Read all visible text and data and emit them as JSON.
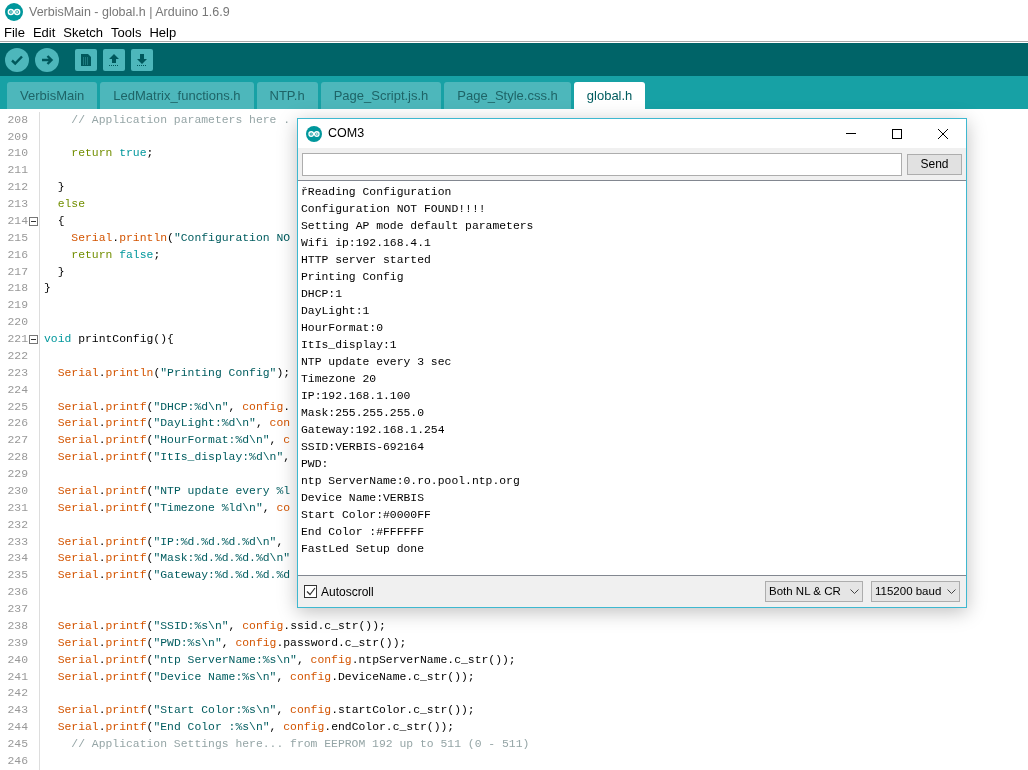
{
  "window": {
    "title": "VerbisMain - global.h | Arduino 1.6.9"
  },
  "menu": [
    "File",
    "Edit",
    "Sketch",
    "Tools",
    "Help"
  ],
  "tabs": [
    {
      "label": "VerbisMain",
      "selected": false
    },
    {
      "label": "LedMatrix_functions.h",
      "selected": false
    },
    {
      "label": "NTP.h",
      "selected": false
    },
    {
      "label": "Page_Script.js.h",
      "selected": false
    },
    {
      "label": "Page_Style.css.h",
      "selected": false
    },
    {
      "label": "global.h",
      "selected": true
    }
  ],
  "editor": {
    "lines": [
      {
        "number": "208",
        "fold": false,
        "code": [
          {
            "kind": "comment",
            "text": "    // Application parameters here ."
          }
        ]
      },
      {
        "number": "209",
        "fold": false
      },
      {
        "number": "210",
        "fold": false,
        "code": [
          {
            "kind": "keyword",
            "text": "    return"
          },
          {
            "kind": "literal",
            "text": " true"
          },
          {
            "kind": "plain",
            "text": ";"
          }
        ]
      },
      {
        "number": "211",
        "fold": false
      },
      {
        "number": "212",
        "fold": false,
        "code": [
          {
            "kind": "plain",
            "text": "  }"
          }
        ]
      },
      {
        "number": "213",
        "fold": false,
        "code": [
          {
            "kind": "keyword",
            "text": "  else"
          }
        ]
      },
      {
        "number": "214",
        "fold": true,
        "code": [
          {
            "kind": "plain",
            "text": "  {"
          }
        ]
      },
      {
        "number": "215",
        "fold": false,
        "code": [
          {
            "kind": "class",
            "text": "    Serial"
          },
          {
            "kind": "plain",
            "text": "."
          },
          {
            "kind": "class",
            "text": "println"
          },
          {
            "kind": "plain",
            "text": "("
          },
          {
            "kind": "string",
            "text": "\"Configuration NO"
          }
        ]
      },
      {
        "number": "216",
        "fold": false,
        "code": [
          {
            "kind": "keyword",
            "text": "    return"
          },
          {
            "kind": "literal",
            "text": " false"
          },
          {
            "kind": "plain",
            "text": ";"
          }
        ]
      },
      {
        "number": "217",
        "fold": false,
        "code": [
          {
            "kind": "plain",
            "text": "  }"
          }
        ]
      },
      {
        "number": "218",
        "fold": false,
        "code": [
          {
            "kind": "plain",
            "text": "}"
          }
        ]
      },
      {
        "number": "219",
        "fold": false
      },
      {
        "number": "220",
        "fold": false
      },
      {
        "number": "221",
        "fold": true,
        "code": [
          {
            "kind": "literal",
            "text": "void"
          },
          {
            "kind": "plain",
            "text": " printConfig(){"
          }
        ]
      },
      {
        "number": "222",
        "fold": false
      },
      {
        "number": "223",
        "fold": false,
        "code": [
          {
            "kind": "class",
            "text": "  Serial"
          },
          {
            "kind": "plain",
            "text": "."
          },
          {
            "kind": "class",
            "text": "println"
          },
          {
            "kind": "plain",
            "text": "("
          },
          {
            "kind": "string",
            "text": "\"Printing Config\""
          },
          {
            "kind": "plain",
            "text": ");"
          }
        ]
      },
      {
        "number": "224",
        "fold": false
      },
      {
        "number": "225",
        "fold": false,
        "code": [
          {
            "kind": "class",
            "text": "  Serial"
          },
          {
            "kind": "plain",
            "text": "."
          },
          {
            "kind": "class",
            "text": "printf"
          },
          {
            "kind": "plain",
            "text": "("
          },
          {
            "kind": "string",
            "text": "\"DHCP:%d\\n\""
          },
          {
            "kind": "plain",
            "text": ", "
          },
          {
            "kind": "class",
            "text": "config"
          },
          {
            "kind": "plain",
            "text": "."
          }
        ]
      },
      {
        "number": "226",
        "fold": false,
        "code": [
          {
            "kind": "class",
            "text": "  Serial"
          },
          {
            "kind": "plain",
            "text": "."
          },
          {
            "kind": "class",
            "text": "printf"
          },
          {
            "kind": "plain",
            "text": "("
          },
          {
            "kind": "string",
            "text": "\"DayLight:%d\\n\""
          },
          {
            "kind": "plain",
            "text": ","
          },
          {
            "kind": "class",
            "text": " con"
          }
        ]
      },
      {
        "number": "227",
        "fold": false,
        "code": [
          {
            "kind": "class",
            "text": "  Serial"
          },
          {
            "kind": "plain",
            "text": "."
          },
          {
            "kind": "class",
            "text": "printf"
          },
          {
            "kind": "plain",
            "text": "("
          },
          {
            "kind": "string",
            "text": "\"HourFormat:%d\\n\""
          },
          {
            "kind": "plain",
            "text": ","
          },
          {
            "kind": "class",
            "text": " c"
          }
        ]
      },
      {
        "number": "228",
        "fold": false,
        "code": [
          {
            "kind": "class",
            "text": "  Serial"
          },
          {
            "kind": "plain",
            "text": "."
          },
          {
            "kind": "class",
            "text": "printf"
          },
          {
            "kind": "plain",
            "text": "("
          },
          {
            "kind": "string",
            "text": "\"ItIs_display:%d\\n\""
          },
          {
            "kind": "plain",
            "text": ","
          }
        ]
      },
      {
        "number": "229",
        "fold": false
      },
      {
        "number": "230",
        "fold": false,
        "code": [
          {
            "kind": "class",
            "text": "  Serial"
          },
          {
            "kind": "plain",
            "text": "."
          },
          {
            "kind": "class",
            "text": "printf"
          },
          {
            "kind": "plain",
            "text": "("
          },
          {
            "kind": "string",
            "text": "\"NTP update every %l"
          }
        ]
      },
      {
        "number": "231",
        "fold": false,
        "code": [
          {
            "kind": "class",
            "text": "  Serial"
          },
          {
            "kind": "plain",
            "text": "."
          },
          {
            "kind": "class",
            "text": "printf"
          },
          {
            "kind": "plain",
            "text": "("
          },
          {
            "kind": "string",
            "text": "\"Timezone %ld\\n\""
          },
          {
            "kind": "plain",
            "text": ","
          },
          {
            "kind": "class",
            "text": " co"
          }
        ]
      },
      {
        "number": "232",
        "fold": false
      },
      {
        "number": "233",
        "fold": false,
        "code": [
          {
            "kind": "class",
            "text": "  Serial"
          },
          {
            "kind": "plain",
            "text": "."
          },
          {
            "kind": "class",
            "text": "printf"
          },
          {
            "kind": "plain",
            "text": "("
          },
          {
            "kind": "string",
            "text": "\"IP:%d.%d.%d.%d\\n\""
          },
          {
            "kind": "plain",
            "text": ","
          }
        ]
      },
      {
        "number": "234",
        "fold": false,
        "code": [
          {
            "kind": "class",
            "text": "  Serial"
          },
          {
            "kind": "plain",
            "text": "."
          },
          {
            "kind": "class",
            "text": "printf"
          },
          {
            "kind": "plain",
            "text": "("
          },
          {
            "kind": "string",
            "text": "\"Mask:%d.%d.%d.%d\\n\""
          }
        ]
      },
      {
        "number": "235",
        "fold": false,
        "code": [
          {
            "kind": "class",
            "text": "  Serial"
          },
          {
            "kind": "plain",
            "text": "."
          },
          {
            "kind": "class",
            "text": "printf"
          },
          {
            "kind": "plain",
            "text": "("
          },
          {
            "kind": "string",
            "text": "\"Gateway:%d.%d.%d.%d"
          }
        ]
      },
      {
        "number": "236",
        "fold": false
      },
      {
        "number": "237",
        "fold": false
      },
      {
        "number": "238",
        "fold": false,
        "code": [
          {
            "kind": "class",
            "text": "  Serial"
          },
          {
            "kind": "plain",
            "text": "."
          },
          {
            "kind": "class",
            "text": "printf"
          },
          {
            "kind": "plain",
            "text": "("
          },
          {
            "kind": "string",
            "text": "\"SSID:%s\\n\""
          },
          {
            "kind": "plain",
            "text": ","
          },
          {
            "kind": "class",
            "text": " config"
          },
          {
            "kind": "plain",
            "text": ".ssid.c_str());"
          }
        ]
      },
      {
        "number": "239",
        "fold": false,
        "code": [
          {
            "kind": "class",
            "text": "  Serial"
          },
          {
            "kind": "plain",
            "text": "."
          },
          {
            "kind": "class",
            "text": "printf"
          },
          {
            "kind": "plain",
            "text": "("
          },
          {
            "kind": "string",
            "text": "\"PWD:%s\\n\""
          },
          {
            "kind": "plain",
            "text": ","
          },
          {
            "kind": "class",
            "text": " config"
          },
          {
            "kind": "plain",
            "text": ".password.c_str());"
          }
        ]
      },
      {
        "number": "240",
        "fold": false,
        "code": [
          {
            "kind": "class",
            "text": "  Serial"
          },
          {
            "kind": "plain",
            "text": "."
          },
          {
            "kind": "class",
            "text": "printf"
          },
          {
            "kind": "plain",
            "text": "("
          },
          {
            "kind": "string",
            "text": "\"ntp ServerName:%s\\n\""
          },
          {
            "kind": "plain",
            "text": ","
          },
          {
            "kind": "class",
            "text": " config"
          },
          {
            "kind": "plain",
            "text": ".ntpServerName.c_str());"
          }
        ]
      },
      {
        "number": "241",
        "fold": false,
        "code": [
          {
            "kind": "class",
            "text": "  Serial"
          },
          {
            "kind": "plain",
            "text": "."
          },
          {
            "kind": "class",
            "text": "printf"
          },
          {
            "kind": "plain",
            "text": "("
          },
          {
            "kind": "string",
            "text": "\"Device Name:%s\\n\""
          },
          {
            "kind": "plain",
            "text": ","
          },
          {
            "kind": "class",
            "text": " config"
          },
          {
            "kind": "plain",
            "text": ".DeviceName.c_str());"
          }
        ]
      },
      {
        "number": "242",
        "fold": false
      },
      {
        "number": "243",
        "fold": false,
        "code": [
          {
            "kind": "class",
            "text": "  Serial"
          },
          {
            "kind": "plain",
            "text": "."
          },
          {
            "kind": "class",
            "text": "printf"
          },
          {
            "kind": "plain",
            "text": "("
          },
          {
            "kind": "string",
            "text": "\"Start Color:%s\\n\""
          },
          {
            "kind": "plain",
            "text": ","
          },
          {
            "kind": "class",
            "text": " config"
          },
          {
            "kind": "plain",
            "text": ".startColor.c_str());"
          }
        ]
      },
      {
        "number": "244",
        "fold": false,
        "code": [
          {
            "kind": "class",
            "text": "  Serial"
          },
          {
            "kind": "plain",
            "text": "."
          },
          {
            "kind": "class",
            "text": "printf"
          },
          {
            "kind": "plain",
            "text": "("
          },
          {
            "kind": "string",
            "text": "\"End Color :%s\\n\""
          },
          {
            "kind": "plain",
            "text": ","
          },
          {
            "kind": "class",
            "text": " config"
          },
          {
            "kind": "plain",
            "text": ".endColor.c_str());"
          }
        ]
      },
      {
        "number": "245",
        "fold": false,
        "code": [
          {
            "kind": "comment",
            "text": "    // Application Settings here... from EEPROM 192 up to 511 (0 - 511)"
          }
        ]
      },
      {
        "number": "246",
        "fold": false
      }
    ]
  },
  "serial_monitor": {
    "title": "COM3",
    "send_button": "Send",
    "output": [
      "řReading Configuration",
      "Configuration NOT FOUND!!!!",
      "Setting AP mode default parameters",
      "Wifi ip:192.168.4.1",
      "HTTP server started",
      "Printing Config",
      "DHCP:1",
      "DayLight:1",
      "HourFormat:0",
      "ItIs_display:1",
      "NTP update every 3 sec",
      "Timezone 20",
      "IP:192.168.1.100",
      "Mask:255.255.255.0",
      "Gateway:192.168.1.254",
      "SSID:VERBIS-692164",
      "PWD:",
      "ntp ServerName:0.ro.pool.ntp.org",
      "Device Name:VERBIS",
      "Start Color:#0000FF",
      "End Color :#FFFFFF",
      "FastLed Setup done"
    ],
    "autoscroll": {
      "label": "Autoscroll",
      "checked": true
    },
    "line_ending": "Both NL & CR",
    "baud_rate": "115200 baud"
  }
}
